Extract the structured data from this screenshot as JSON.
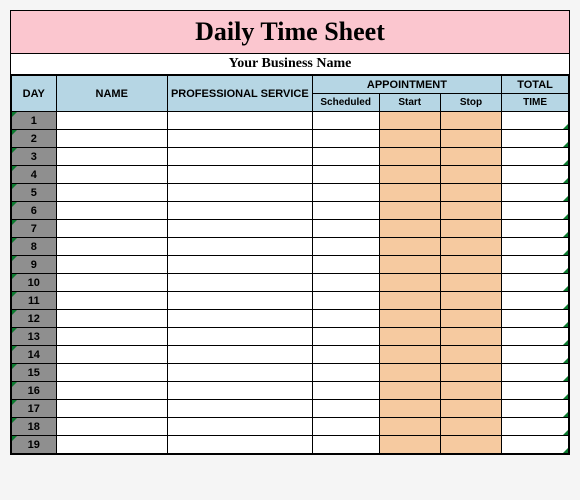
{
  "title": "Daily Time Sheet",
  "subtitle": "Your Business Name",
  "headers": {
    "day": "DAY",
    "name": "NAME",
    "professional": "PROFESSIONAL SERVICE",
    "appointment": "APPOINTMENT",
    "scheduled": "Scheduled",
    "start": "Start",
    "stop": "Stop",
    "total": "TOTAL",
    "time": "TIME"
  },
  "rows": [
    {
      "day": "1",
      "name": "",
      "professional": "",
      "scheduled": "",
      "start": "",
      "stop": "",
      "total": ""
    },
    {
      "day": "2",
      "name": "",
      "professional": "",
      "scheduled": "",
      "start": "",
      "stop": "",
      "total": ""
    },
    {
      "day": "3",
      "name": "",
      "professional": "",
      "scheduled": "",
      "start": "",
      "stop": "",
      "total": ""
    },
    {
      "day": "4",
      "name": "",
      "professional": "",
      "scheduled": "",
      "start": "",
      "stop": "",
      "total": ""
    },
    {
      "day": "5",
      "name": "",
      "professional": "",
      "scheduled": "",
      "start": "",
      "stop": "",
      "total": ""
    },
    {
      "day": "6",
      "name": "",
      "professional": "",
      "scheduled": "",
      "start": "",
      "stop": "",
      "total": ""
    },
    {
      "day": "7",
      "name": "",
      "professional": "",
      "scheduled": "",
      "start": "",
      "stop": "",
      "total": ""
    },
    {
      "day": "8",
      "name": "",
      "professional": "",
      "scheduled": "",
      "start": "",
      "stop": "",
      "total": ""
    },
    {
      "day": "9",
      "name": "",
      "professional": "",
      "scheduled": "",
      "start": "",
      "stop": "",
      "total": ""
    },
    {
      "day": "10",
      "name": "",
      "professional": "",
      "scheduled": "",
      "start": "",
      "stop": "",
      "total": ""
    },
    {
      "day": "11",
      "name": "",
      "professional": "",
      "scheduled": "",
      "start": "",
      "stop": "",
      "total": ""
    },
    {
      "day": "12",
      "name": "",
      "professional": "",
      "scheduled": "",
      "start": "",
      "stop": "",
      "total": ""
    },
    {
      "day": "13",
      "name": "",
      "professional": "",
      "scheduled": "",
      "start": "",
      "stop": "",
      "total": ""
    },
    {
      "day": "14",
      "name": "",
      "professional": "",
      "scheduled": "",
      "start": "",
      "stop": "",
      "total": ""
    },
    {
      "day": "15",
      "name": "",
      "professional": "",
      "scheduled": "",
      "start": "",
      "stop": "",
      "total": ""
    },
    {
      "day": "16",
      "name": "",
      "professional": "",
      "scheduled": "",
      "start": "",
      "stop": "",
      "total": ""
    },
    {
      "day": "17",
      "name": "",
      "professional": "",
      "scheduled": "",
      "start": "",
      "stop": "",
      "total": ""
    },
    {
      "day": "18",
      "name": "",
      "professional": "",
      "scheduled": "",
      "start": "",
      "stop": "",
      "total": ""
    },
    {
      "day": "19",
      "name": "",
      "professional": "",
      "scheduled": "",
      "start": "",
      "stop": "",
      "total": ""
    }
  ]
}
